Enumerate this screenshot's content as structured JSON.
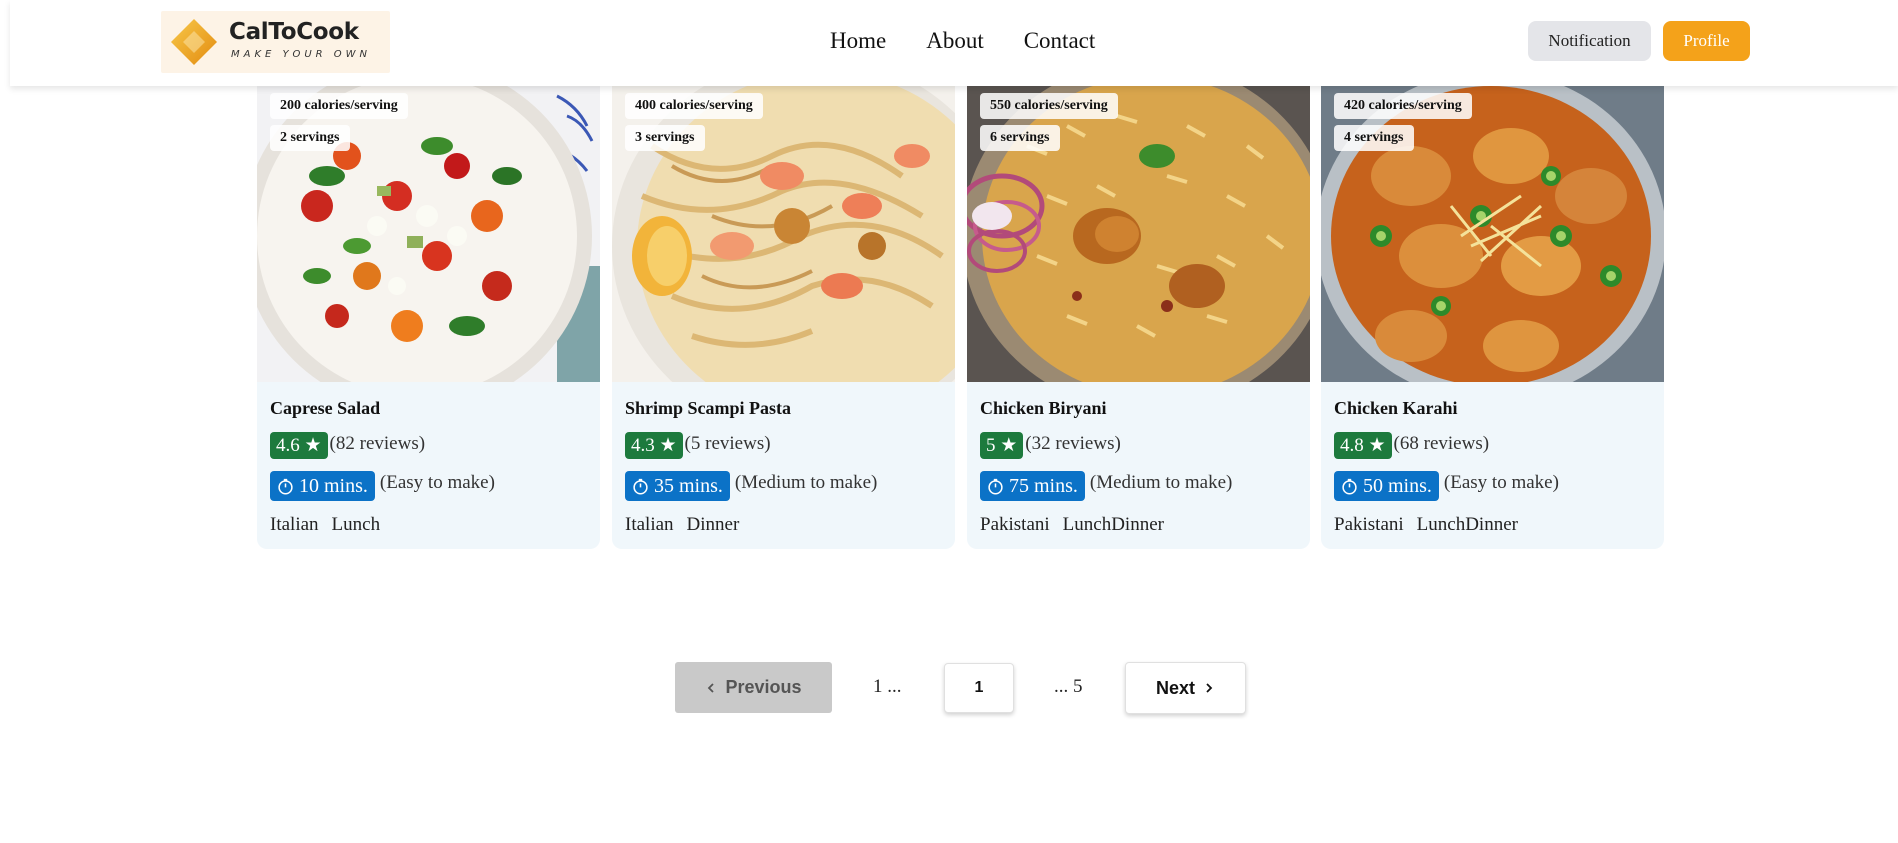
{
  "header": {
    "logo_title": "CalToCook",
    "logo_tagline": "MAKE YOUR OWN",
    "nav": [
      "Home",
      "About",
      "Contact"
    ],
    "notification_label": "Notification",
    "profile_label": "Profile",
    "colors": {
      "accent": "#f4a21a",
      "notification_bg": "#e4e5e9"
    }
  },
  "recipes": [
    {
      "title": "Caprese Salad",
      "calories": "200 calories/serving",
      "servings": "2 servings",
      "rating": "4.6 ★",
      "reviews": "(82 reviews)",
      "time": "10 mins.",
      "difficulty": "(Easy to make)",
      "tags": [
        "Italian",
        "Lunch"
      ]
    },
    {
      "title": "Shrimp Scampi Pasta",
      "calories": "400 calories/serving",
      "servings": "3 servings",
      "rating": "4.3 ★",
      "reviews": "(5 reviews)",
      "time": "35 mins.",
      "difficulty": "(Medium to make)",
      "tags": [
        "Italian",
        "Dinner"
      ]
    },
    {
      "title": "Chicken Biryani",
      "calories": "550 calories/serving",
      "servings": "6 servings",
      "rating": "5 ★",
      "reviews": "(32 reviews)",
      "time": "75 mins.",
      "difficulty": "(Medium to make)",
      "tags": [
        "Pakistani",
        "LunchDinner"
      ]
    },
    {
      "title": "Chicken Karahi",
      "calories": "420 calories/serving",
      "servings": "4 servings",
      "rating": "4.8 ★",
      "reviews": "(68 reviews)",
      "time": "50 mins.",
      "difficulty": "(Easy to make)",
      "tags": [
        "Pakistani",
        "LunchDinner"
      ]
    }
  ],
  "pagination": {
    "previous_label": "Previous",
    "first": "1 ...",
    "current": "1",
    "last": "... 5",
    "next_label": "Next"
  },
  "colors": {
    "card_bg": "#f0f7fb",
    "rating_badge": "#1d7a3d",
    "time_badge": "#0b72c7",
    "prev_disabled": "#c9c9c9"
  }
}
